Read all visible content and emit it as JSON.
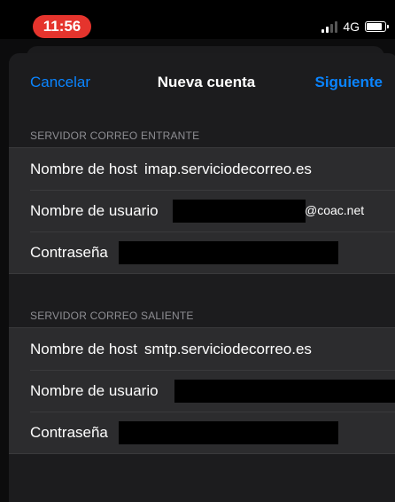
{
  "status_bar": {
    "time": "11:56",
    "network": "4G"
  },
  "nav": {
    "cancel_label": "Cancelar",
    "title": "Nueva cuenta",
    "next_label": "Siguiente"
  },
  "incoming": {
    "header": "SERVIDOR CORREO ENTRANTE",
    "host_label": "Nombre de host",
    "host_value": "imap.serviciodecorreo.es",
    "user_label": "Nombre de usuario",
    "user_suffix": "@coac.net",
    "password_label": "Contraseña"
  },
  "outgoing": {
    "header": "SERVIDOR CORREO SALIENTE",
    "host_label": "Nombre de host",
    "host_value": "smtp.serviciodecorreo.es",
    "user_label": "Nombre de usuario",
    "password_label": "Contraseña"
  }
}
